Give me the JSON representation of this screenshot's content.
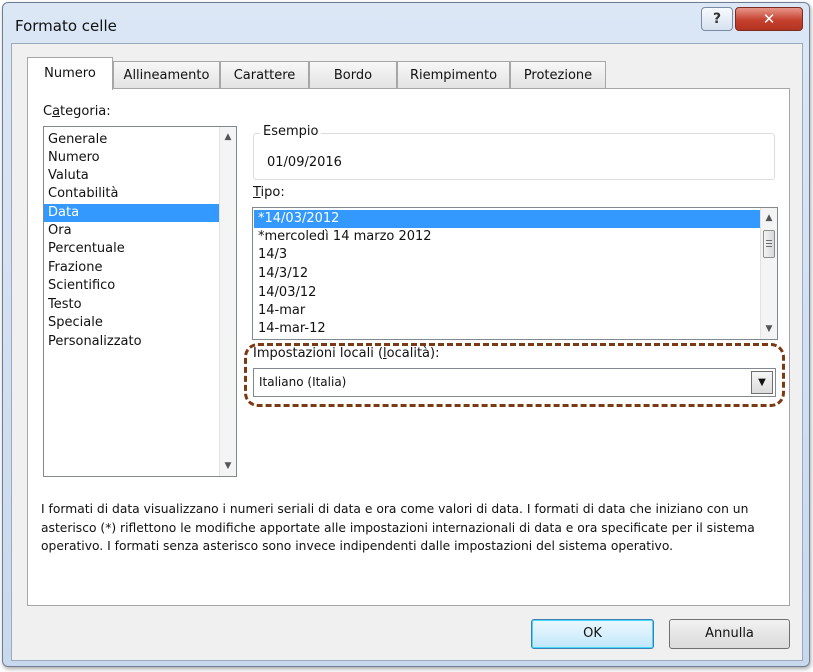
{
  "window": {
    "title": "Formato celle",
    "help_label": "?",
    "close_label": "✕"
  },
  "tabs": [
    {
      "label": "Numero",
      "active": true
    },
    {
      "label": "Allineamento",
      "active": false
    },
    {
      "label": "Carattere",
      "active": false
    },
    {
      "label": "Bordo",
      "active": false
    },
    {
      "label": "Riempimento",
      "active": false
    },
    {
      "label": "Protezione",
      "active": false
    }
  ],
  "category": {
    "label_pre": "C",
    "label_ul": "a",
    "label_post": "tegoria:",
    "items": [
      "Generale",
      "Numero",
      "Valuta",
      "Contabilità",
      "Data",
      "Ora",
      "Percentuale",
      "Frazione",
      "Scientifico",
      "Testo",
      "Speciale",
      "Personalizzato"
    ],
    "selected": "Data"
  },
  "example": {
    "label": "Esempio",
    "value": "01/09/2016"
  },
  "type": {
    "label_ul": "T",
    "label_post": "ipo:",
    "items": [
      "*14/03/2012",
      "*mercoledì 14 marzo 2012",
      "14/3",
      "14/3/12",
      "14/03/12",
      "14-mar",
      "14-mar-12"
    ],
    "selected": "*14/03/2012"
  },
  "locale": {
    "label_pre": "Impostazioni locali (",
    "label_ul": "l",
    "label_post": "ocalità):",
    "value": "Italiano (Italia)"
  },
  "description": "I formati di data visualizzano i numeri seriali di data e ora come valori di data. I formati di data che iniziano con un asterisco (*) riflettono le modifiche apportate alle impostazioni internazionali di data e ora specificate per il sistema operativo. I formati senza asterisco sono invece indipendenti dalle impostazioni del sistema operativo.",
  "buttons": {
    "ok": "OK",
    "cancel": "Annulla"
  },
  "colors": {
    "selection": "#3399ff",
    "highlight_border": "#7b3a14",
    "close_button": "#c6412e"
  }
}
